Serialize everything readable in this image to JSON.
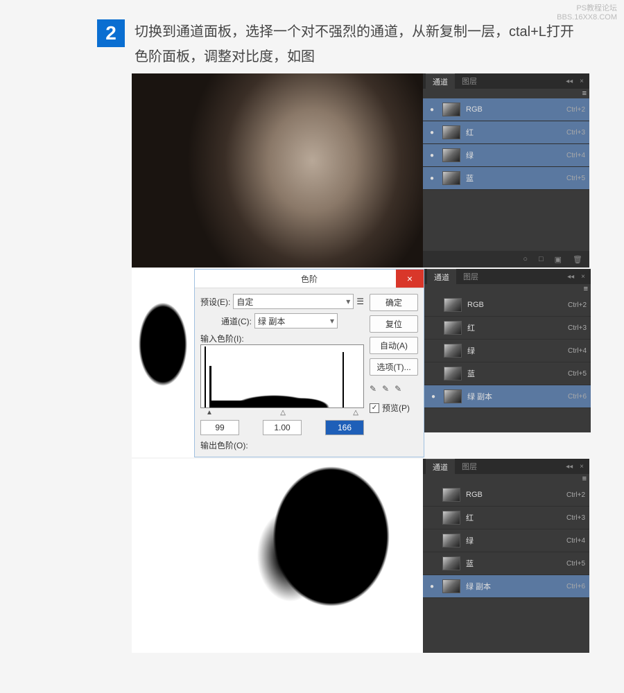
{
  "watermark": {
    "line1": "PS教程论坛",
    "line2": "BBS.16XX8.COM"
  },
  "step": {
    "number": "2",
    "text": "切换到通道面板，选择一个对不强烈的通道，从新复制一层，ctal+L打开色阶面板，调整对比度，如图"
  },
  "panel_tabs": {
    "channels": "通道",
    "layers": "图层",
    "menu": "≡",
    "close": "×",
    "collapse": "◂◂"
  },
  "channels1": [
    {
      "name": "RGB",
      "shortcut": "Ctrl+2",
      "eye": true,
      "sel": true
    },
    {
      "name": "红",
      "shortcut": "Ctrl+3",
      "eye": true,
      "sel": true
    },
    {
      "name": "绿",
      "shortcut": "Ctrl+4",
      "eye": true,
      "sel": true
    },
    {
      "name": "蓝",
      "shortcut": "Ctrl+5",
      "eye": true,
      "sel": true
    }
  ],
  "channels2": [
    {
      "name": "RGB",
      "shortcut": "Ctrl+2",
      "eye": false,
      "sel": false
    },
    {
      "name": "红",
      "shortcut": "Ctrl+3",
      "eye": false,
      "sel": false
    },
    {
      "name": "绿",
      "shortcut": "Ctrl+4",
      "eye": false,
      "sel": false
    },
    {
      "name": "蓝",
      "shortcut": "Ctrl+5",
      "eye": false,
      "sel": false
    },
    {
      "name": "绿 副本",
      "shortcut": "Ctrl+6",
      "eye": true,
      "sel": true
    }
  ],
  "channels3": [
    {
      "name": "RGB",
      "shortcut": "Ctrl+2",
      "eye": false,
      "sel": false
    },
    {
      "name": "红",
      "shortcut": "Ctrl+3",
      "eye": false,
      "sel": false
    },
    {
      "name": "绿",
      "shortcut": "Ctrl+4",
      "eye": false,
      "sel": false
    },
    {
      "name": "蓝",
      "shortcut": "Ctrl+5",
      "eye": false,
      "sel": false
    },
    {
      "name": "绿 副本",
      "shortcut": "Ctrl+6",
      "eye": true,
      "sel": true
    }
  ],
  "levels": {
    "title": "色阶",
    "preset_label": "预设(E):",
    "preset_value": "自定",
    "channel_label": "通道(C):",
    "channel_value": "绿 副本",
    "input_label": "输入色阶(I):",
    "output_label": "输出色阶(O):",
    "shadow": "99",
    "mid": "1.00",
    "highlight": "166",
    "btn_ok": "确定",
    "btn_reset": "复位",
    "btn_auto": "自动(A)",
    "btn_options": "选项(T)...",
    "preview_label": "预览(P)",
    "preview_checked": true
  },
  "footer_icons": {
    "sel": "○",
    "mask": "□",
    "new": "▣",
    "trash": "🗑"
  }
}
